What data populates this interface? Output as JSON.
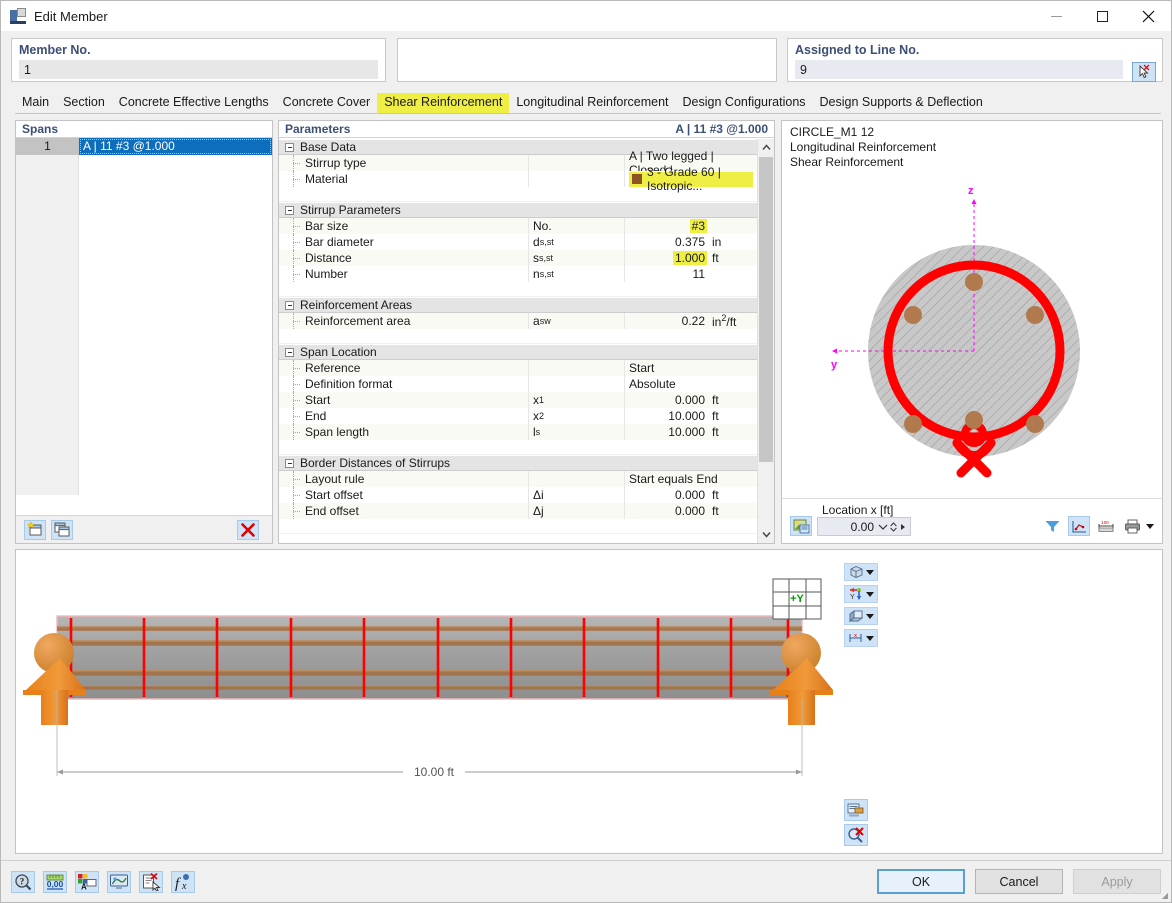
{
  "window": {
    "title": "Edit Member",
    "icon": "member-icon",
    "minimize": "—",
    "maximize": "□",
    "close": "✕"
  },
  "header": {
    "member_no": {
      "label": "Member No.",
      "value": "1"
    },
    "middle": {
      "label": "",
      "value": ""
    },
    "assigned_line": {
      "label": "Assigned to Line No.",
      "value": "9",
      "pick_icon": "pick-cursor-icon"
    }
  },
  "tabs": [
    {
      "label": "Main",
      "active": false
    },
    {
      "label": "Section",
      "active": false
    },
    {
      "label": "Concrete Effective Lengths",
      "active": false
    },
    {
      "label": "Concrete Cover",
      "active": false
    },
    {
      "label": "Shear Reinforcement",
      "active": true
    },
    {
      "label": "Longitudinal Reinforcement",
      "active": false
    },
    {
      "label": "Design Configurations",
      "active": false
    },
    {
      "label": "Design Supports & Deflection",
      "active": false
    }
  ],
  "spans": {
    "header": "Spans",
    "rows": [
      {
        "no": "1",
        "value": "A | 11 #3 @1.000"
      }
    ],
    "toolbar": [
      {
        "name": "new-span-button",
        "icon": "new-window-icon"
      },
      {
        "name": "duplicate-span-button",
        "icon": "copy-window-icon"
      },
      {
        "name": "delete-span-button",
        "icon": "red-x-icon",
        "glyph": "✕"
      }
    ]
  },
  "parameters": {
    "header": "Parameters",
    "header_right": "A | 11 #3 @1.000",
    "groups": [
      {
        "name": "Base Data",
        "rows": [
          {
            "label": "Stirrup type",
            "symbol": "",
            "value": "A | Two legged | Closed | ...",
            "unit": "",
            "highlight": false,
            "align": "left"
          },
          {
            "label": "Material",
            "symbol": "",
            "value": "3 - Grade 60 | Isotropic...",
            "unit": "",
            "highlight": true,
            "align": "left",
            "swatch": "#8a5423"
          }
        ]
      },
      {
        "name": "Stirrup Parameters",
        "rows": [
          {
            "label": "Bar size",
            "symbol": "No.",
            "value": "#3",
            "unit": "",
            "highlight": true,
            "align": "right"
          },
          {
            "label": "Bar diameter",
            "symbol": "ds,st",
            "value": "0.375",
            "unit": "in",
            "highlight": false,
            "align": "right"
          },
          {
            "label": "Distance",
            "symbol": "ss,st",
            "value": "1.000",
            "unit": "ft",
            "highlight": true,
            "align": "right"
          },
          {
            "label": "Number",
            "symbol": "ns,st",
            "value": "11",
            "unit": "",
            "highlight": false,
            "align": "right"
          }
        ]
      },
      {
        "name": "Reinforcement Areas",
        "rows": [
          {
            "label": "Reinforcement area",
            "symbol": "asw",
            "value": "0.22",
            "unit": "in2/ft",
            "highlight": false,
            "align": "right"
          }
        ]
      },
      {
        "name": "Span Location",
        "rows": [
          {
            "label": "Reference",
            "symbol": "",
            "value": "Start",
            "unit": "",
            "highlight": false,
            "align": "left"
          },
          {
            "label": "Definition format",
            "symbol": "",
            "value": "Absolute",
            "unit": "",
            "highlight": false,
            "align": "left"
          },
          {
            "label": "Start",
            "symbol": "x1",
            "value": "0.000",
            "unit": "ft",
            "highlight": false,
            "align": "right"
          },
          {
            "label": "End",
            "symbol": "x2",
            "value": "10.000",
            "unit": "ft",
            "highlight": false,
            "align": "right"
          },
          {
            "label": "Span length",
            "symbol": "ls",
            "value": "10.000",
            "unit": "ft",
            "highlight": false,
            "align": "right"
          }
        ]
      },
      {
        "name": "Border Distances of Stirrups",
        "rows": [
          {
            "label": "Layout rule",
            "symbol": "",
            "value": "Start equals End",
            "unit": "",
            "highlight": false,
            "align": "left"
          },
          {
            "label": "Start offset",
            "symbol": "Δi",
            "value": "0.000",
            "unit": "ft",
            "highlight": false,
            "align": "right"
          },
          {
            "label": "End offset",
            "symbol": "Δj",
            "value": "0.000",
            "unit": "ft",
            "highlight": false,
            "align": "right"
          }
        ]
      }
    ]
  },
  "section_view": {
    "lines": [
      "CIRCLE_M1 12",
      "Longitudinal Reinforcement",
      "Shear Reinforcement"
    ],
    "axis_z": "z",
    "axis_y": "y",
    "location_label": "Location x [ft]",
    "location_value": "0.00",
    "colors": {
      "concrete_fill": "#c8c8c8",
      "stirrup": "#fe0000",
      "rebar": "#b07a4e",
      "axis": "#ff00ff"
    },
    "rebar_count": 6,
    "toolbar": [
      {
        "name": "render-settings-button",
        "icon": "image-settings-icon"
      },
      {
        "name": "filter-button",
        "icon": "funnel-icon"
      },
      {
        "name": "section-view-button",
        "icon": "section-axes-icon"
      },
      {
        "name": "dimension-button",
        "icon": "ruler-icon"
      },
      {
        "name": "print-button",
        "icon": "printer-icon"
      }
    ]
  },
  "beam_view": {
    "dimension_label": "10.00 ft",
    "axis_cube_label": "+Y",
    "stirrup_color": "#fe0000",
    "support_color": "#e8801a",
    "view_buttons": [
      {
        "name": "render-mode-button",
        "icon": "cube-icon"
      },
      {
        "name": "axis-direction-button",
        "icon": "axis-arrows-icon"
      },
      {
        "name": "shading-button",
        "icon": "shaded-box-icon"
      },
      {
        "name": "dimensions-button",
        "icon": "dimension-icon"
      }
    ],
    "bottom_buttons": [
      {
        "name": "display-properties-button",
        "icon": "display-props-icon"
      },
      {
        "name": "clear-selection-button",
        "icon": "magnifier-x-icon"
      }
    ]
  },
  "bottom_bar": {
    "tools": [
      {
        "name": "help-button",
        "icon": "question-magnifier-icon"
      },
      {
        "name": "units-button",
        "icon": "units-ruler-icon"
      },
      {
        "name": "comment-button",
        "icon": "comment-color-icon"
      },
      {
        "name": "visualization-button",
        "icon": "monitor-icon"
      },
      {
        "name": "delete-object-button",
        "icon": "page-x-icon"
      },
      {
        "name": "formula-button",
        "icon": "function-icon"
      }
    ],
    "ok": "OK",
    "cancel": "Cancel",
    "apply": "Apply"
  }
}
